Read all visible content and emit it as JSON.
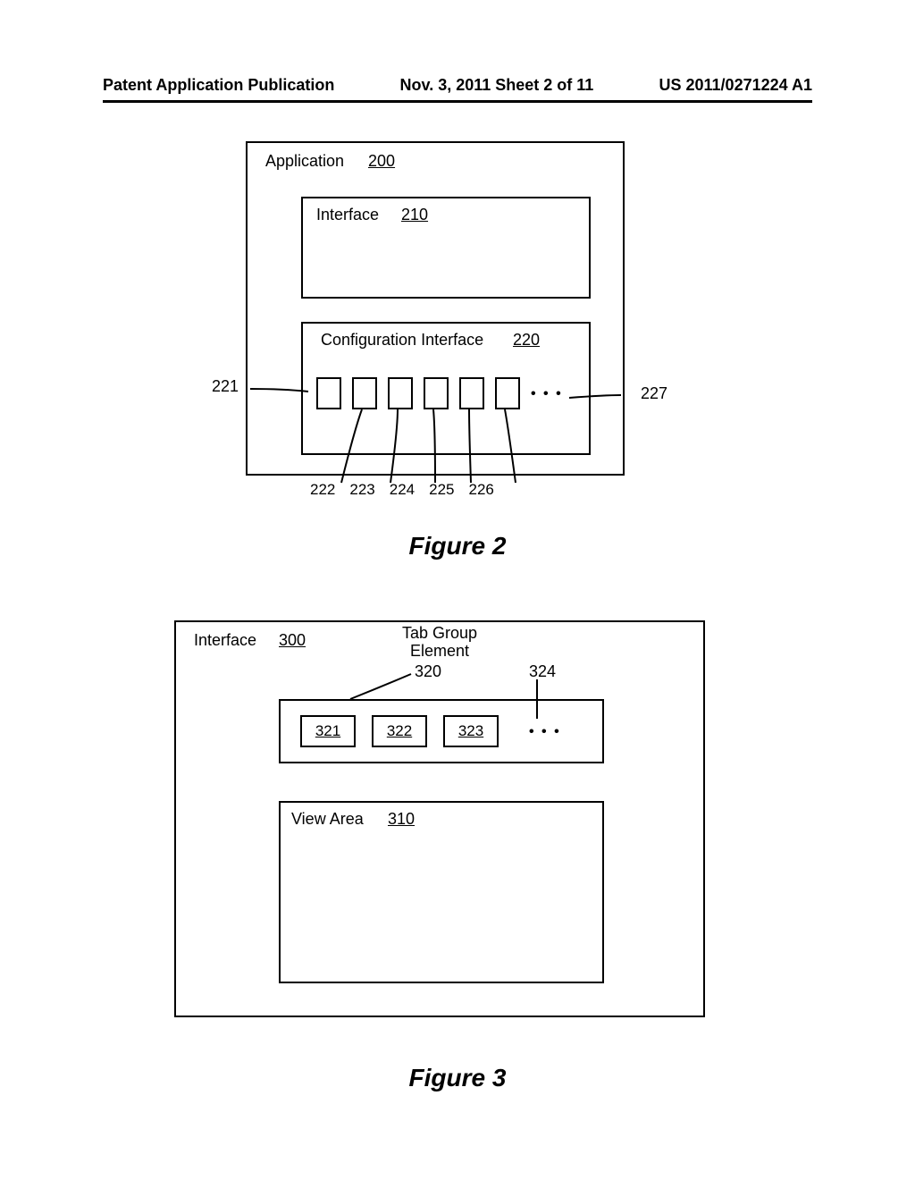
{
  "header": {
    "left": "Patent Application Publication",
    "center": "Nov. 3, 2011  Sheet 2 of 11",
    "right": "US 2011/0271224 A1"
  },
  "fig2": {
    "app_label": "Application",
    "app_num": "200",
    "interface_label": "Interface",
    "interface_num": "210",
    "config_label": "Configuration Interface",
    "config_num": "220",
    "callout_left": "221",
    "callout_right": "227",
    "bottom_nums": [
      "222",
      "223",
      "224",
      "225",
      "226"
    ],
    "dots": "• • •",
    "caption": "Figure 2"
  },
  "fig3": {
    "interface_label": "Interface",
    "interface_num": "300",
    "tabgroup_label_line1": "Tab Group",
    "tabgroup_label_line2": "Element",
    "tabgroup_num": "320",
    "tab_324": "324",
    "tabs": [
      "321",
      "322",
      "323"
    ],
    "tab_dots": "• • •",
    "view_label": "View Area",
    "view_num": "310",
    "caption": "Figure 3"
  }
}
